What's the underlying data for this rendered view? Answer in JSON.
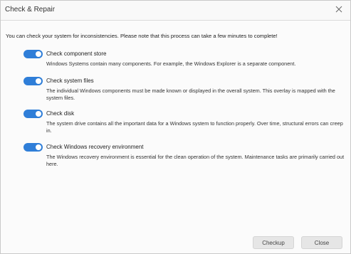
{
  "window": {
    "title": "Check & Repair"
  },
  "intro": "You can check your system for inconsistencies. Please note that this process can take a few minutes to complete!",
  "options": [
    {
      "title": "Check component store",
      "description": "Windows Systems contain many components. For example, the Windows Explorer is a separate component.",
      "enabled": true
    },
    {
      "title": "Check system files",
      "description": "The individual Windows components must be made known or displayed in the overall system. This overlay is mapped with the system files.",
      "enabled": true
    },
    {
      "title": "Check disk",
      "description": "The system drive contains all the important data for a Windows system to function properly. Over time, structural errors can creep in.",
      "enabled": true
    },
    {
      "title": "Check Windows recovery environment",
      "description": "The Windows recovery environment is essential for the clean operation of the system. Maintenance tasks are primarily carried out here.",
      "enabled": true
    }
  ],
  "buttons": {
    "checkup": "Checkup",
    "close": "Close"
  },
  "colors": {
    "accent": "#2f7ed8",
    "button_bg": "#e6e6e6"
  }
}
